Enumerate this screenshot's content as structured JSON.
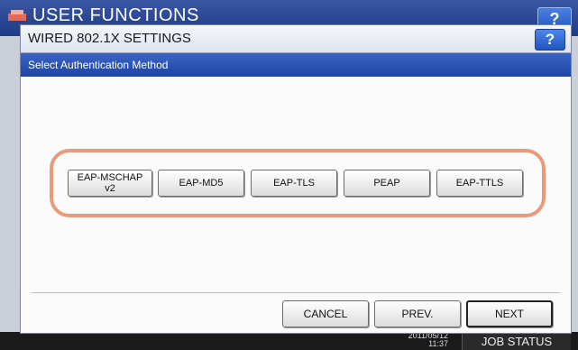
{
  "background": {
    "title": "USER FUNCTIONS",
    "help_label": "?",
    "clock_line1": "2011/05/12",
    "clock_line2": "11:37",
    "job_status_label": "JOB STATUS"
  },
  "dialog": {
    "title": "WIRED 802.1X SETTINGS",
    "help_label": "?",
    "subtitle": "Select Authentication Method",
    "methods": [
      {
        "label": "EAP-MSCHAP\nv2"
      },
      {
        "label": "EAP-MD5"
      },
      {
        "label": "EAP-TLS"
      },
      {
        "label": "PEAP"
      },
      {
        "label": "EAP-TTLS"
      }
    ],
    "buttons": {
      "cancel": "CANCEL",
      "prev": "PREV.",
      "next": "NEXT"
    }
  },
  "colors": {
    "highlight": "#e89a7a",
    "title_bar_blue": "#1f3a85"
  }
}
